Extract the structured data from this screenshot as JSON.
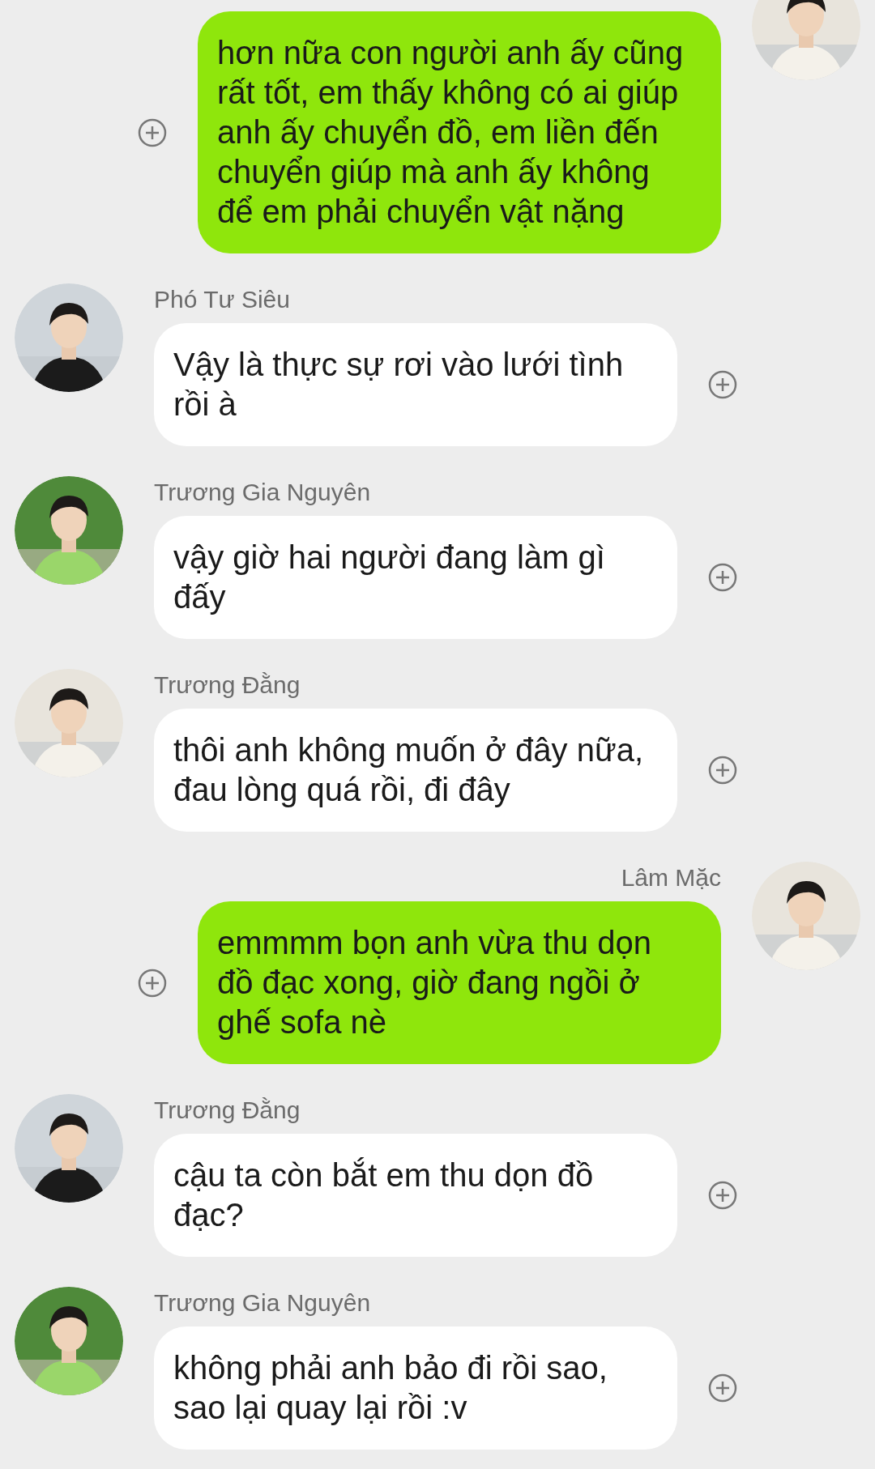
{
  "messages": [
    {
      "kind": "sent",
      "text": "hơn nữa con người anh ấy cũng rất tốt, em thấy không có ai giúp anh ấy chuyển đồ, em liền đến chuyển giúp mà anh ấy không để em phải chuyển vật nặng"
    },
    {
      "kind": "received",
      "name": "Phó Tư Siêu",
      "text": "Vậy là thực sự rơi vào lưới tình rồi à"
    },
    {
      "kind": "received",
      "name": "Trương Gia Nguyên",
      "text": "vậy giờ hai người đang làm gì đấy"
    },
    {
      "kind": "received",
      "name": "Trương Đằng",
      "text": "thôi anh không muốn ở đây nữa, đau lòng quá rồi, đi đây"
    },
    {
      "kind": "sent",
      "name": "Lâm Mặc",
      "text": "emmmm bọn anh vừa thu dọn đồ đạc xong, giờ đang ngồi ở ghế sofa nè"
    },
    {
      "kind": "received",
      "name": "Trương Đằng",
      "text": "cậu ta còn bắt em thu dọn đồ đạc?"
    },
    {
      "kind": "received",
      "name": "Trương Gia Nguyên",
      "text": "không phải anh bảo đi rồi sao, sao lại quay lại rồi :v"
    }
  ]
}
